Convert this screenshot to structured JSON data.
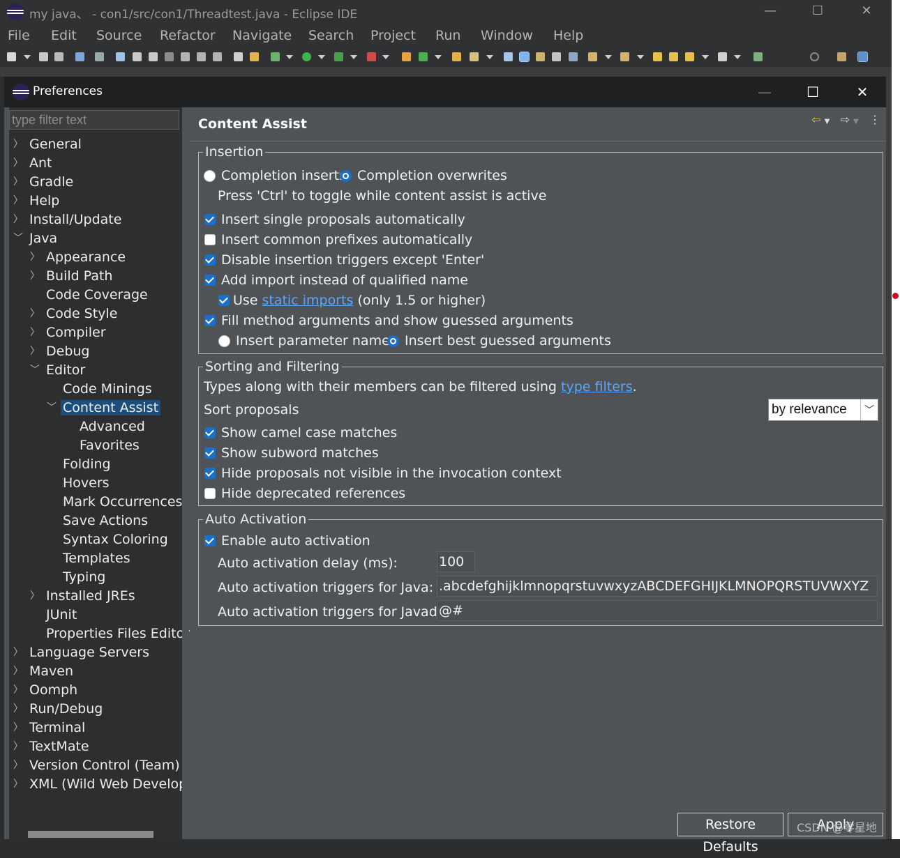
{
  "ide": {
    "title": "my java、 - con1/src/con1/Threadtest.java - Eclipse IDE",
    "menu": [
      "File",
      "Edit",
      "Source",
      "Refactor",
      "Navigate",
      "Search",
      "Project",
      "Run",
      "Window",
      "Help"
    ]
  },
  "dialog": {
    "title": "Preferences",
    "filter_placeholder": "type filter text",
    "tree": [
      {
        "label": "General"
      },
      {
        "label": "Ant"
      },
      {
        "label": "Gradle"
      },
      {
        "label": "Help"
      },
      {
        "label": "Install/Update"
      },
      {
        "label": "Java"
      },
      {
        "label": "Appearance"
      },
      {
        "label": "Build Path"
      },
      {
        "label": "Code Coverage"
      },
      {
        "label": "Code Style"
      },
      {
        "label": "Compiler"
      },
      {
        "label": "Debug"
      },
      {
        "label": "Editor"
      },
      {
        "label": "Code Minings"
      },
      {
        "label": "Content Assist"
      },
      {
        "label": "Advanced"
      },
      {
        "label": "Favorites"
      },
      {
        "label": "Folding"
      },
      {
        "label": "Hovers"
      },
      {
        "label": "Mark Occurrences"
      },
      {
        "label": "Save Actions"
      },
      {
        "label": "Syntax Coloring"
      },
      {
        "label": "Templates"
      },
      {
        "label": "Typing"
      },
      {
        "label": "Installed JREs"
      },
      {
        "label": "JUnit"
      },
      {
        "label": "Properties Files Editor"
      },
      {
        "label": "Language Servers"
      },
      {
        "label": "Maven"
      },
      {
        "label": "Oomph"
      },
      {
        "label": "Run/Debug"
      },
      {
        "label": "Terminal"
      },
      {
        "label": "TextMate"
      },
      {
        "label": "Version Control (Team)"
      },
      {
        "label": "XML (Wild Web Developer)"
      }
    ],
    "selected_item": "Content Assist",
    "page_title": "Content Assist",
    "insertion": {
      "title": "Insertion",
      "radio_inserts": "Completion inserts",
      "radio_overwrites": "Completion overwrites",
      "toggle_hint": "Press 'Ctrl' to toggle while content assist is active",
      "single_proposals": "Insert single proposals automatically",
      "common_prefixes": "Insert common prefixes automatically",
      "disable_triggers": "Disable insertion triggers except 'Enter'",
      "add_import": "Add import instead of qualified name",
      "use_prefix": "Use",
      "static_imports": "static imports",
      "use_suffix": "(only 1.5 or higher)",
      "fill_arguments": "Fill method arguments and show guessed arguments",
      "param_names": "Insert parameter names",
      "best_guessed": "Insert best guessed arguments"
    },
    "sorting": {
      "title": "Sorting and Filtering",
      "types_text": "Types along with their members can be filtered using",
      "type_filters": "type filters",
      "period": ".",
      "sort_label": "Sort proposals",
      "sort_value": "by relevance",
      "camel_case": "Show camel case matches",
      "subword": "Show subword matches",
      "hide_not_visible": "Hide proposals not visible in the invocation context",
      "hide_deprecated": "Hide deprecated references"
    },
    "auto_activation": {
      "title": "Auto Activation",
      "enable": "Enable auto activation",
      "delay_label": "Auto activation delay (ms):",
      "delay_value": "100",
      "java_label": "Auto activation triggers for Java:",
      "java_value": ".abcdefghijklmnopqrstuvwxyzABCDEFGHIJKLMNOPQRSTUVWXYZ",
      "javadoc_label": "Auto activation triggers for Javadoc:",
      "javadoc_value": "@#"
    },
    "buttons": {
      "restore_defaults": "Restore Defaults",
      "apply": "Apply"
    }
  },
  "watermark": "CSDN @零星地",
  "colors": {
    "accent": "#1a6fc9",
    "selection": "#1c4e7c",
    "link": "#5aa6ff"
  }
}
